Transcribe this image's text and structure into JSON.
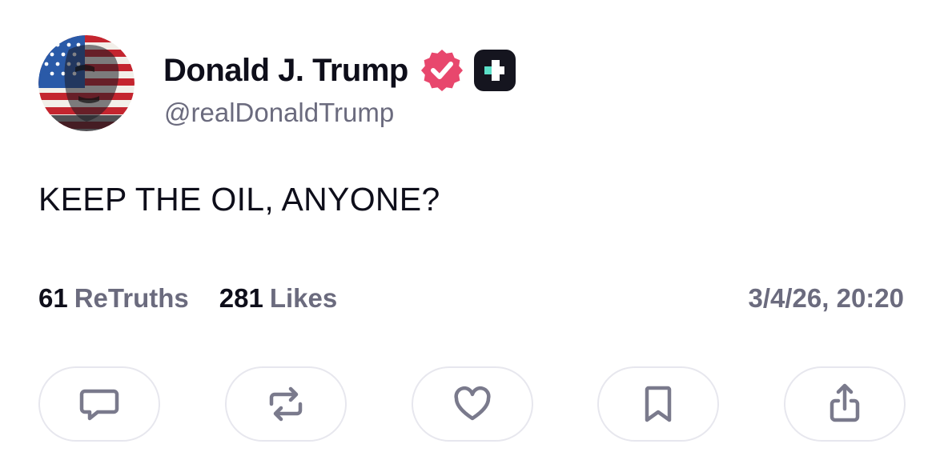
{
  "author": {
    "display_name": "Donald J. Trump",
    "handle": "@realDonaldTrump",
    "verified": true,
    "avatar_icon": "flag-portrait-avatar",
    "badges": [
      "verified-badge-icon",
      "plus-badge-icon"
    ]
  },
  "post": {
    "text": "KEEP THE OIL, ANYONE?",
    "timestamp": "3/4/26, 20:20"
  },
  "stats": {
    "retruths_count": "61",
    "retruths_label": "ReTruths",
    "likes_count": "281",
    "likes_label": "Likes"
  },
  "actions": [
    {
      "name": "reply",
      "icon": "comment-icon"
    },
    {
      "name": "retruth",
      "icon": "repost-icon"
    },
    {
      "name": "like",
      "icon": "heart-icon"
    },
    {
      "name": "bookmark",
      "icon": "bookmark-icon"
    },
    {
      "name": "share",
      "icon": "share-icon"
    }
  ],
  "colors": {
    "text_primary": "#0e0e1a",
    "text_secondary": "#6b6b7e",
    "verified_pink": "#e8476d",
    "icon_gray": "#7a7a8c",
    "button_border": "#e7e7ee",
    "plus_badge_bg": "#15151f",
    "plus_badge_accent": "#5be0c8"
  }
}
